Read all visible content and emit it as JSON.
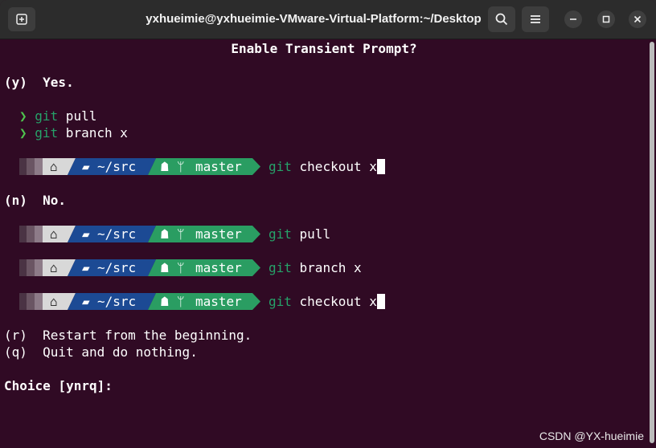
{
  "window": {
    "title": "yxhueimie@yxhueimie-VMware-Virtual-Platform:~/Desktop"
  },
  "terminal": {
    "heading": "Enable Transient Prompt?",
    "option_yes": "(y)  Yes.",
    "yes_history": [
      {
        "cmd": "git",
        "args": " pull"
      },
      {
        "cmd": "git",
        "args": " branch x"
      }
    ],
    "option_no": "(n)  No.",
    "prompt": {
      "dir": "~/src",
      "branch": "master"
    },
    "yes_prompt_line": {
      "cmd": "git",
      "args": " checkout x"
    },
    "no_lines": [
      {
        "cmd": "git",
        "args": " pull"
      },
      {
        "cmd": "git",
        "args": " branch x"
      },
      {
        "cmd": "git",
        "args": " checkout x"
      }
    ],
    "option_restart": "(r)  Restart from the beginning.",
    "option_quit": "(q)  Quit and do nothing.",
    "choice": "Choice [ynrq]:"
  },
  "watermark": "CSDN @YX-hueimie",
  "colors": {
    "background": "#300a24",
    "dir_segment": "#1c4a94",
    "git_segment": "#2a9d62",
    "command": "#26a269"
  },
  "icons": {
    "new_tab": "new-tab-icon",
    "search": "search-icon",
    "menu": "hamburger-menu-icon",
    "minimize": "minimize-icon",
    "maximize": "maximize-icon",
    "close": "close-icon"
  }
}
